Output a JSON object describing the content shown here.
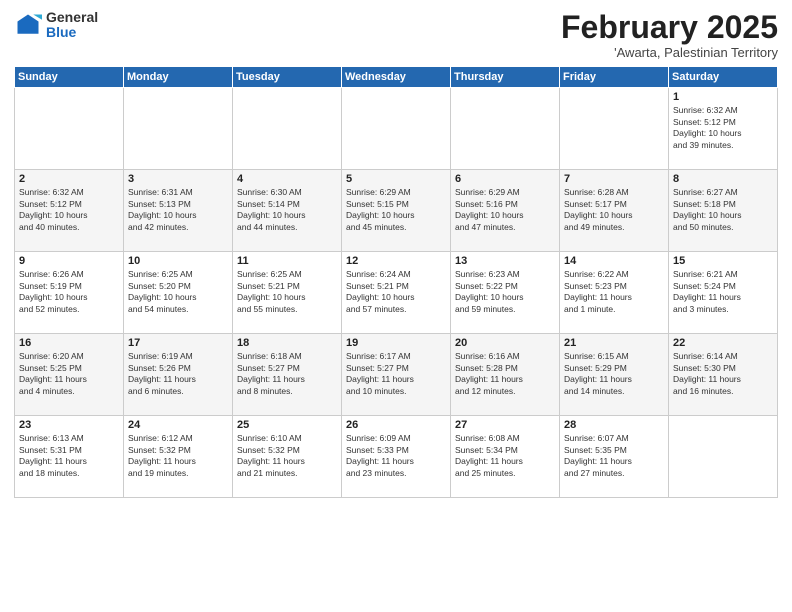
{
  "logo": {
    "general": "General",
    "blue": "Blue"
  },
  "title": "February 2025",
  "subtitle": "'Awarta, Palestinian Territory",
  "days_header": [
    "Sunday",
    "Monday",
    "Tuesday",
    "Wednesday",
    "Thursday",
    "Friday",
    "Saturday"
  ],
  "weeks": [
    [
      {
        "day": "",
        "info": ""
      },
      {
        "day": "",
        "info": ""
      },
      {
        "day": "",
        "info": ""
      },
      {
        "day": "",
        "info": ""
      },
      {
        "day": "",
        "info": ""
      },
      {
        "day": "",
        "info": ""
      },
      {
        "day": "1",
        "info": "Sunrise: 6:32 AM\nSunset: 5:12 PM\nDaylight: 10 hours\nand 39 minutes."
      }
    ],
    [
      {
        "day": "2",
        "info": "Sunrise: 6:32 AM\nSunset: 5:12 PM\nDaylight: 10 hours\nand 40 minutes."
      },
      {
        "day": "3",
        "info": "Sunrise: 6:31 AM\nSunset: 5:13 PM\nDaylight: 10 hours\nand 42 minutes."
      },
      {
        "day": "4",
        "info": "Sunrise: 6:30 AM\nSunset: 5:14 PM\nDaylight: 10 hours\nand 44 minutes."
      },
      {
        "day": "5",
        "info": "Sunrise: 6:29 AM\nSunset: 5:15 PM\nDaylight: 10 hours\nand 45 minutes."
      },
      {
        "day": "6",
        "info": "Sunrise: 6:29 AM\nSunset: 5:16 PM\nDaylight: 10 hours\nand 47 minutes."
      },
      {
        "day": "7",
        "info": "Sunrise: 6:28 AM\nSunset: 5:17 PM\nDaylight: 10 hours\nand 49 minutes."
      },
      {
        "day": "8",
        "info": "Sunrise: 6:27 AM\nSunset: 5:18 PM\nDaylight: 10 hours\nand 50 minutes."
      }
    ],
    [
      {
        "day": "9",
        "info": "Sunrise: 6:26 AM\nSunset: 5:19 PM\nDaylight: 10 hours\nand 52 minutes."
      },
      {
        "day": "10",
        "info": "Sunrise: 6:25 AM\nSunset: 5:20 PM\nDaylight: 10 hours\nand 54 minutes."
      },
      {
        "day": "11",
        "info": "Sunrise: 6:25 AM\nSunset: 5:21 PM\nDaylight: 10 hours\nand 55 minutes."
      },
      {
        "day": "12",
        "info": "Sunrise: 6:24 AM\nSunset: 5:21 PM\nDaylight: 10 hours\nand 57 minutes."
      },
      {
        "day": "13",
        "info": "Sunrise: 6:23 AM\nSunset: 5:22 PM\nDaylight: 10 hours\nand 59 minutes."
      },
      {
        "day": "14",
        "info": "Sunrise: 6:22 AM\nSunset: 5:23 PM\nDaylight: 11 hours\nand 1 minute."
      },
      {
        "day": "15",
        "info": "Sunrise: 6:21 AM\nSunset: 5:24 PM\nDaylight: 11 hours\nand 3 minutes."
      }
    ],
    [
      {
        "day": "16",
        "info": "Sunrise: 6:20 AM\nSunset: 5:25 PM\nDaylight: 11 hours\nand 4 minutes."
      },
      {
        "day": "17",
        "info": "Sunrise: 6:19 AM\nSunset: 5:26 PM\nDaylight: 11 hours\nand 6 minutes."
      },
      {
        "day": "18",
        "info": "Sunrise: 6:18 AM\nSunset: 5:27 PM\nDaylight: 11 hours\nand 8 minutes."
      },
      {
        "day": "19",
        "info": "Sunrise: 6:17 AM\nSunset: 5:27 PM\nDaylight: 11 hours\nand 10 minutes."
      },
      {
        "day": "20",
        "info": "Sunrise: 6:16 AM\nSunset: 5:28 PM\nDaylight: 11 hours\nand 12 minutes."
      },
      {
        "day": "21",
        "info": "Sunrise: 6:15 AM\nSunset: 5:29 PM\nDaylight: 11 hours\nand 14 minutes."
      },
      {
        "day": "22",
        "info": "Sunrise: 6:14 AM\nSunset: 5:30 PM\nDaylight: 11 hours\nand 16 minutes."
      }
    ],
    [
      {
        "day": "23",
        "info": "Sunrise: 6:13 AM\nSunset: 5:31 PM\nDaylight: 11 hours\nand 18 minutes."
      },
      {
        "day": "24",
        "info": "Sunrise: 6:12 AM\nSunset: 5:32 PM\nDaylight: 11 hours\nand 19 minutes."
      },
      {
        "day": "25",
        "info": "Sunrise: 6:10 AM\nSunset: 5:32 PM\nDaylight: 11 hours\nand 21 minutes."
      },
      {
        "day": "26",
        "info": "Sunrise: 6:09 AM\nSunset: 5:33 PM\nDaylight: 11 hours\nand 23 minutes."
      },
      {
        "day": "27",
        "info": "Sunrise: 6:08 AM\nSunset: 5:34 PM\nDaylight: 11 hours\nand 25 minutes."
      },
      {
        "day": "28",
        "info": "Sunrise: 6:07 AM\nSunset: 5:35 PM\nDaylight: 11 hours\nand 27 minutes."
      },
      {
        "day": "",
        "info": ""
      }
    ]
  ]
}
